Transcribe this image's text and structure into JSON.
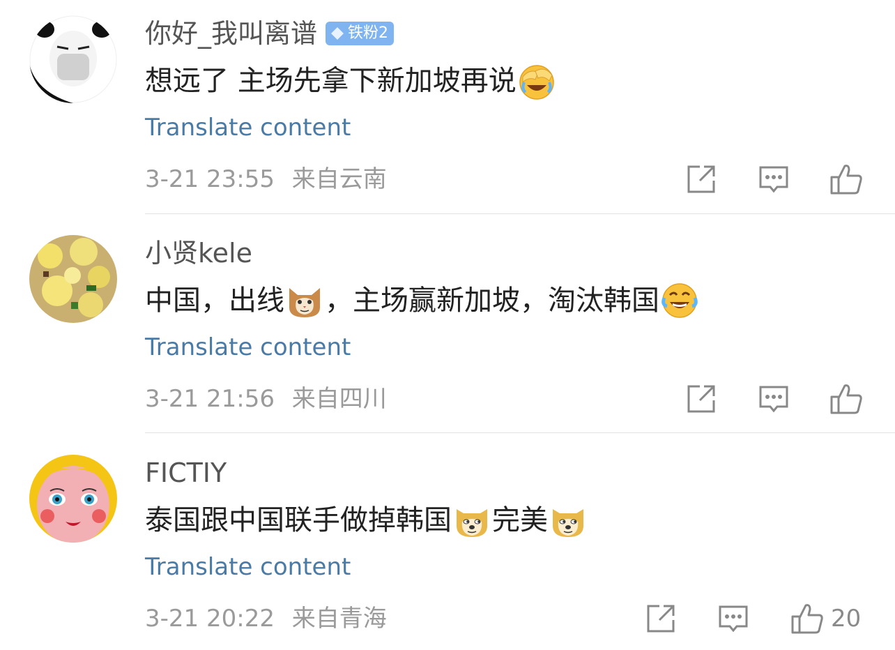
{
  "comments": [
    {
      "username": "你好_我叫离谱",
      "badge": "铁粉2",
      "content_parts": [
        "想远了 主场先拿下新加坡再说"
      ],
      "translate": "Translate content",
      "time": "3-21 23:55",
      "location": "来自云南",
      "likes": ""
    },
    {
      "username": "小贤kele",
      "content_parts": [
        "中国，出线",
        "，主场赢新加坡，淘汰韩国"
      ],
      "translate": "Translate content",
      "time": "3-21 21:56",
      "location": "来自四川",
      "likes": ""
    },
    {
      "username": "FICTIY",
      "content_parts": [
        "泰国跟中国联手做掉韩国",
        "完美"
      ],
      "translate": "Translate content",
      "time": "3-21 20:22",
      "location": "来自青海",
      "likes": "20"
    }
  ],
  "icons": {
    "share": "share-icon",
    "comment": "comment-icon",
    "like": "thumbs-up-icon",
    "emoji_facepalm": "facepalm-laugh-emoji",
    "emoji_tears": "tears-of-joy-emoji",
    "emoji_cat": "cat-face-emoji",
    "emoji_doge": "doge-emoji"
  },
  "colors": {
    "link": "#4a7aa6",
    "meta": "#9a9a9a",
    "badge": "#7fb4f0"
  }
}
